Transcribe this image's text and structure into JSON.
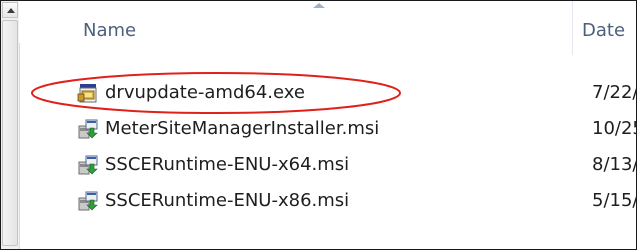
{
  "columns": {
    "name": "Name",
    "date": "Date"
  },
  "files": [
    {
      "name": "drvupdate-amd64.exe",
      "date": "7/22/",
      "icon": "exe-installer-icon",
      "highlighted": true
    },
    {
      "name": "MeterSiteManagerInstaller.msi",
      "date": "10/25",
      "icon": "msi-installer-icon",
      "highlighted": false
    },
    {
      "name": "SSCERuntime-ENU-x64.msi",
      "date": "8/13/",
      "icon": "msi-installer-icon",
      "highlighted": false
    },
    {
      "name": "SSCERuntime-ENU-x86.msi",
      "date": "5/15/",
      "icon": "msi-installer-icon",
      "highlighted": false
    }
  ],
  "colors": {
    "header_text": "#4c607a",
    "highlight": "#e0201b"
  }
}
